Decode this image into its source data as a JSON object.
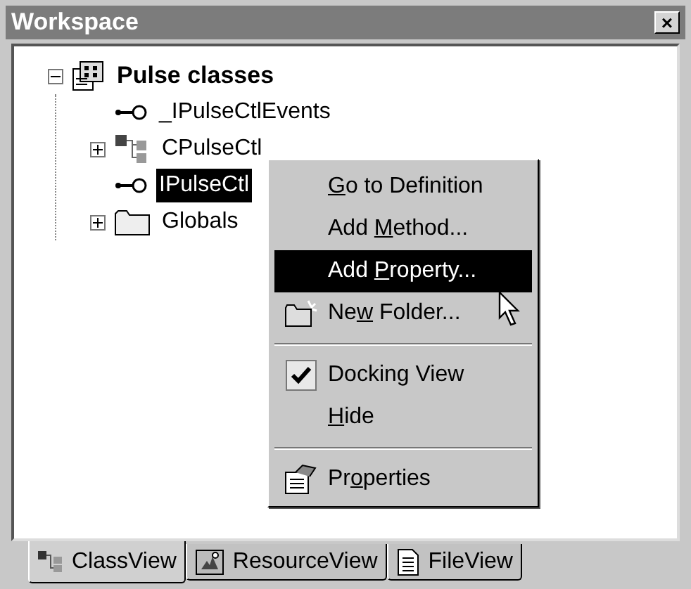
{
  "window": {
    "title": "Workspace",
    "close_glyph": "×"
  },
  "tree": {
    "label": "Pulse classes",
    "kind": "project",
    "expanded": true,
    "selected": false,
    "children": [
      {
        "label": "_IPulseCtlEvents",
        "kind": "interface",
        "selected": false
      },
      {
        "label": "CPulseCtl",
        "kind": "class",
        "expanded": false,
        "selected": false
      },
      {
        "label": "IPulseCtl",
        "kind": "interface",
        "selected": true
      },
      {
        "label": "Globals",
        "kind": "folder",
        "expanded": false,
        "selected": false
      }
    ]
  },
  "context_menu": {
    "items": [
      {
        "kind": "item",
        "key": "G",
        "after": "o to Definition",
        "selected": false
      },
      {
        "kind": "item",
        "before": "Add ",
        "key": "M",
        "after": "ethod...",
        "selected": false
      },
      {
        "kind": "item",
        "before": "Add ",
        "key": "P",
        "after": "roperty...",
        "selected": true
      },
      {
        "kind": "new_folder",
        "before": "Ne",
        "key": "w",
        "after": " Folder...",
        "selected": false
      },
      {
        "kind": "separator"
      },
      {
        "kind": "check",
        "before": "Docking View",
        "checked": true,
        "selected": false
      },
      {
        "kind": "item",
        "key": "H",
        "after": "ide",
        "selected": false
      },
      {
        "kind": "separator"
      },
      {
        "kind": "properties",
        "before": "Pr",
        "key": "o",
        "after": "perties",
        "selected": false
      }
    ]
  },
  "tabs": [
    {
      "label": "ClassView",
      "kind": "class",
      "selected": true
    },
    {
      "label": "ResourceView",
      "kind": "resource",
      "selected": false
    },
    {
      "label": "FileView",
      "kind": "file",
      "selected": false
    }
  ]
}
